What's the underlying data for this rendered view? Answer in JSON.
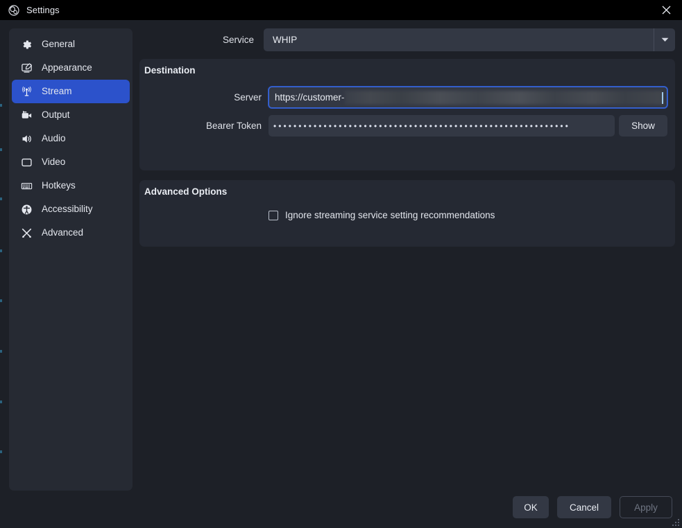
{
  "window": {
    "title": "Settings",
    "app_icon": "obs-logo-icon",
    "close_icon": "close-icon"
  },
  "sidebar": {
    "items": [
      {
        "label": "General",
        "icon": "gear-icon",
        "selected": false
      },
      {
        "label": "Appearance",
        "icon": "appearance-icon",
        "selected": false
      },
      {
        "label": "Stream",
        "icon": "broadcast-icon",
        "selected": true
      },
      {
        "label": "Output",
        "icon": "video-camera-icon",
        "selected": false
      },
      {
        "label": "Audio",
        "icon": "speaker-icon",
        "selected": false
      },
      {
        "label": "Video",
        "icon": "monitor-icon",
        "selected": false
      },
      {
        "label": "Hotkeys",
        "icon": "keyboard-icon",
        "selected": false
      },
      {
        "label": "Accessibility",
        "icon": "accessibility-icon",
        "selected": false
      },
      {
        "label": "Advanced",
        "icon": "tools-icon",
        "selected": false
      }
    ]
  },
  "service": {
    "label": "Service",
    "value": "WHIP",
    "arrow_icon": "chevron-down-icon"
  },
  "destination": {
    "title": "Destination",
    "server": {
      "label": "Server",
      "value": "https://customer-",
      "redacted": true,
      "focused": true
    },
    "bearer_token": {
      "label": "Bearer Token",
      "masked_value": "•••••••••••••••••••••••••••••••••••••••••••••••••••••••••••",
      "show_label": "Show"
    }
  },
  "advanced_options": {
    "title": "Advanced Options",
    "ignore_recommendations": {
      "label": "Ignore streaming service setting recommendations",
      "checked": false
    }
  },
  "footer": {
    "ok_label": "OK",
    "cancel_label": "Cancel",
    "apply_label": "Apply",
    "apply_enabled": false
  },
  "colors": {
    "window_bg": "#1d2027",
    "titlebar_bg": "#000000",
    "panel_bg": "#252933",
    "sidebar_bg": "#262a33",
    "input_bg": "#333844",
    "accent_selected": "#2c52cb",
    "focus_border": "#3b6ae0",
    "text_primary": "#e9ecf2",
    "text_disabled": "#6f7582",
    "edge_accent": "#2e6f8e"
  }
}
